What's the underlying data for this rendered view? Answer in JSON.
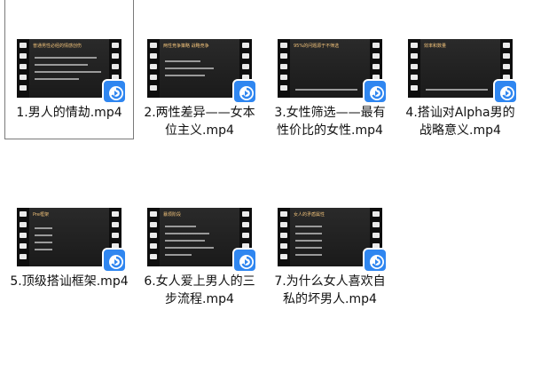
{
  "files": [
    {
      "name": "1.男人的情劫.mp4",
      "selected": true,
      "slide_title": "普通男性必经的情感创伤"
    },
    {
      "name": "2.两性差异——女本位主义.mp4",
      "selected": false,
      "slide_title": "两性竞争策略 战略竞争"
    },
    {
      "name": "3.女性筛选——最有性价比的女性.mp4",
      "selected": false,
      "slide_title": "95%的问题源于不筛选"
    },
    {
      "name": "4.搭讪对Alpha男的战略意义.mp4",
      "selected": false,
      "slide_title": "效率和数量"
    },
    {
      "name": "5.顶级搭讪框架.mp4",
      "selected": false,
      "slide_title": "Pre框架"
    },
    {
      "name": "6.女人爱上男人的三步流程.mp4",
      "selected": false,
      "slide_title": "暴烦阶段"
    },
    {
      "name": "7.为什么女人喜欢自私的坏男人.mp4",
      "selected": false,
      "slide_title": "女人的矛盾属性"
    }
  ],
  "colors": {
    "badge": "#2f86f0",
    "selection_border": "#7a7a7a"
  }
}
